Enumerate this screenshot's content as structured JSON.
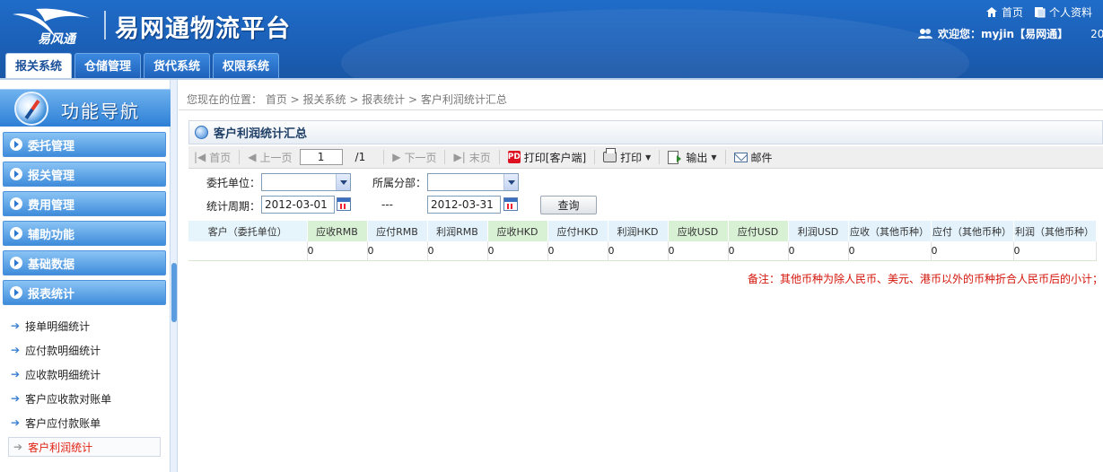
{
  "header": {
    "app_title": "易网通物流平台",
    "logo_text": "易风通",
    "home_link": "首页",
    "profile_link": "个人资料",
    "welcome": "欢迎您：myjin【易网通】",
    "date_fragment": "20"
  },
  "tabs": [
    "报关系统",
    "仓储管理",
    "货代系统",
    "权限系统"
  ],
  "sidebar": {
    "nav_title": "功能导航",
    "groups": [
      "委托管理",
      "报关管理",
      "费用管理",
      "辅助功能",
      "基础数据",
      "报表统计"
    ],
    "items": [
      "接单明细统计",
      "应付款明细统计",
      "应收款明细统计",
      "客户应收款对账单",
      "客户应付款账单",
      "客户利润统计"
    ]
  },
  "breadcrumb": "您现在的位置： 首页 > 报关系统 > 报表统计 > 客户利润统计汇总",
  "panel": {
    "title": "客户利润统计汇总"
  },
  "toolbar": {
    "first": "首页",
    "prev": "上一页",
    "page_value": "1",
    "total_pages": "/1",
    "next": "下一页",
    "last": "末页",
    "print_client": "打印[客户端]",
    "print": "打印",
    "export": "输出",
    "mail": "邮件"
  },
  "filters": {
    "client_label": "委托单位：",
    "dept_label": "所属分部：",
    "period_label": "统计周期：",
    "date_from": "2012-03-01",
    "date_sep": "---",
    "date_to": "2012-03-31",
    "query_button": "查询"
  },
  "table": {
    "headers": [
      "客户（委托单位）",
      "应收RMB",
      "应付RMB",
      "利润RMB",
      "应收HKD",
      "应付HKD",
      "利润HKD",
      "应收USD",
      "应付USD",
      "利润USD",
      "应收（其他币种）",
      "应付（其他币种）",
      "利润（其他币种）"
    ],
    "row": [
      "",
      "0",
      "0",
      "0",
      "0",
      "0",
      "0",
      "0",
      "0",
      "0",
      "0",
      "0",
      "0"
    ]
  },
  "note": "备注：其他币种为除人民币、美元、港币以外的币种折合人民币后的小计；"
}
